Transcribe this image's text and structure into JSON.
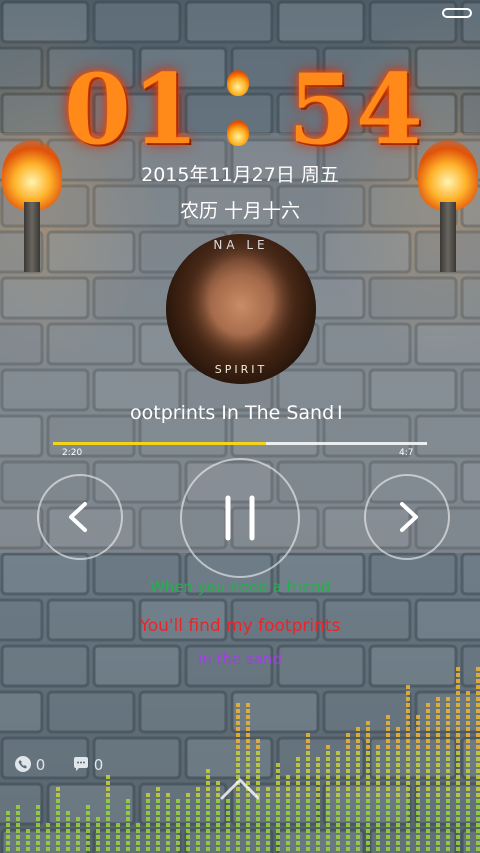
{
  "clock": {
    "d1": "0",
    "d2": "1",
    "d3": "5",
    "d4": "4"
  },
  "date_line": "2015年11月27日 周五",
  "lunar_line": "农历 十月十六",
  "album": {
    "artist_fragment": "NA LE",
    "title_fragment": "SPIRIT"
  },
  "player": {
    "song_title": "ootprints In The Sand",
    "title_cursor": "I",
    "current_time": "2:20",
    "total_time": "4:7",
    "progress": 0.57,
    "state": "playing"
  },
  "lyrics": {
    "previous": "When you need a friend",
    "current": "You'll find my footprints",
    "next": "in the sand"
  },
  "counters": {
    "missed_calls": "0",
    "unread_messages": "0"
  },
  "colors": {
    "progress": "#f2d51a",
    "lyric_previous": "#23b04a",
    "lyric_current": "#e8262a",
    "lyric_next": "#a040e0",
    "fire": "#ff8a1a"
  },
  "icons": [
    "battery-icon",
    "prev-icon",
    "pause-icon",
    "next-icon",
    "phone-icon",
    "message-icon",
    "chevron-up-icon",
    "torch-icon"
  ]
}
